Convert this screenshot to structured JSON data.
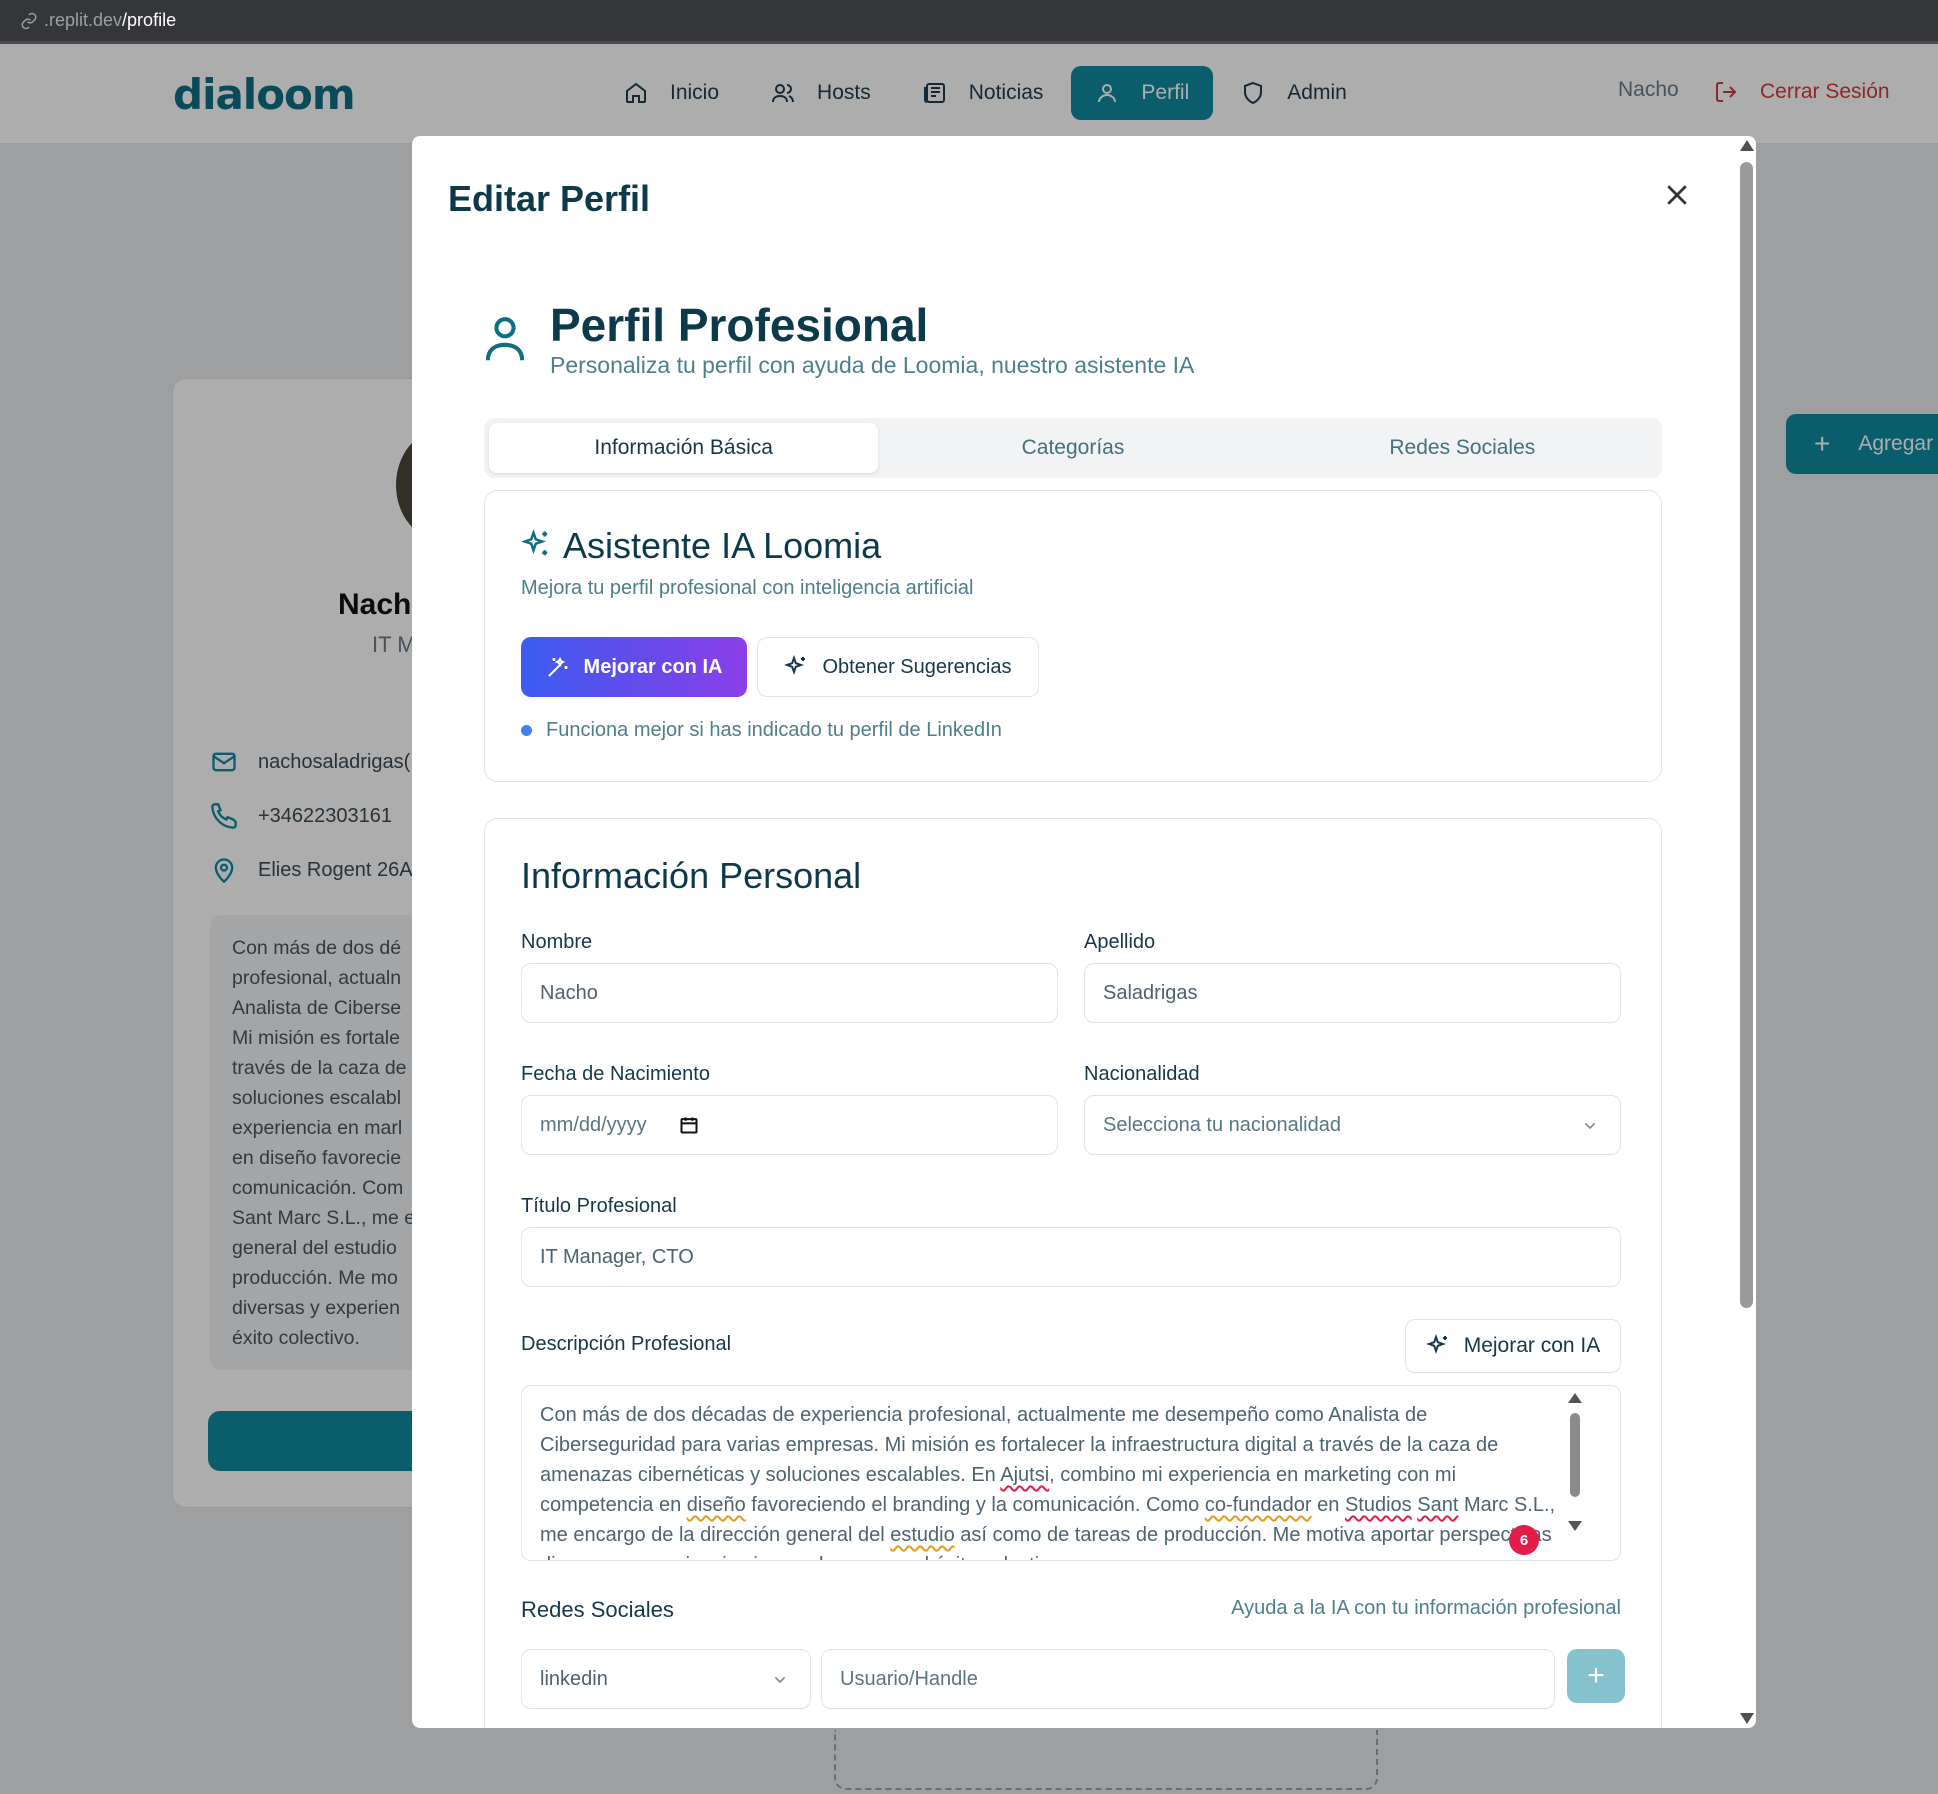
{
  "browser": {
    "url_host": ".replit.dev",
    "url_path": "/profile"
  },
  "header": {
    "logo": "dialoom",
    "nav": [
      {
        "label": "Inicio",
        "icon": "home-icon"
      },
      {
        "label": "Hosts",
        "icon": "users-icon"
      },
      {
        "label": "Noticias",
        "icon": "newspaper-icon"
      },
      {
        "label": "Perfil",
        "icon": "user-icon",
        "active": true
      },
      {
        "label": "Admin",
        "icon": "shield-icon"
      }
    ],
    "user_name": "Nacho",
    "logout_label": "Cerrar Sesión"
  },
  "background": {
    "name": "Nach",
    "title": "IT M",
    "email": "nachosaladrigas(",
    "phone": "+34622303161",
    "address": "Elies Rogent 26A",
    "description": "Con más de dos dé\nprofesional, actualn\nAnalista de Ciberse\nMi misión es fortale\ntravés de la caza de\nsoluciones escalabl\nexperiencia en marl\nen diseño favorecie\ncomunicación. Com\nSant Marc S.L., me e\ngeneral del estudio\nproducción. Me mo\ndiversas y experien\néxito colectivo.",
    "add_button": "Agregar"
  },
  "modal": {
    "title": "Editar Perfil",
    "section_title": "Perfil Profesional",
    "section_subtitle": "Personaliza tu perfil con ayuda de Loomia, nuestro asistente IA",
    "tabs": [
      {
        "label": "Información Básica",
        "active": true
      },
      {
        "label": "Categorías"
      },
      {
        "label": "Redes Sociales"
      }
    ],
    "ai": {
      "title": "Asistente IA Loomia",
      "subtitle": "Mejora tu perfil profesional con inteligencia artificial",
      "improve_button": "Mejorar con IA",
      "suggest_button": "Obtener Sugerencias",
      "tip": "Funciona mejor si has indicado tu perfil de LinkedIn"
    },
    "personal": {
      "title": "Información Personal",
      "first_name_label": "Nombre",
      "first_name_value": "Nacho",
      "last_name_label": "Apellido",
      "last_name_value": "Saladrigas",
      "birth_label": "Fecha de Nacimiento",
      "birth_placeholder": "mm/dd/yyyy",
      "nationality_label": "Nacionalidad",
      "nationality_placeholder": "Selecciona tu nacionalidad",
      "job_title_label": "Título Profesional",
      "job_title_value": "IT Manager, CTO",
      "description_label": "Descripción Profesional",
      "description_ai_button": "Mejorar con IA",
      "description_parts": [
        "Con más de dos décadas de experiencia profesional, actualmente me desempeño como Analista de Ciberseguridad para varias empresas. Mi misión es fortalecer la infraestructura digital a través de la caza de amenazas cibernéticas y soluciones escalables. En ",
        "Ajutsi",
        ", combino mi experiencia en marketing con mi competencia en ",
        "diseño",
        " favoreciendo el branding y la comunicación. Como ",
        "co-fundador",
        " en ",
        "Studios",
        " ",
        "Sant",
        " Marc S.L., me encargo de la dirección general del ",
        "estudio",
        " así como de tareas de producción. Me motiva aportar perspectivas diversas y experiencias innovadoras para el éxito colectivo."
      ],
      "spell_badge": "6",
      "social_label": "Redes Sociales",
      "social_help": "Ayuda a la IA con tu información profesional",
      "social_network_value": "linkedin",
      "social_handle_placeholder": "Usuario/Handle",
      "add_social_button": "+"
    }
  }
}
